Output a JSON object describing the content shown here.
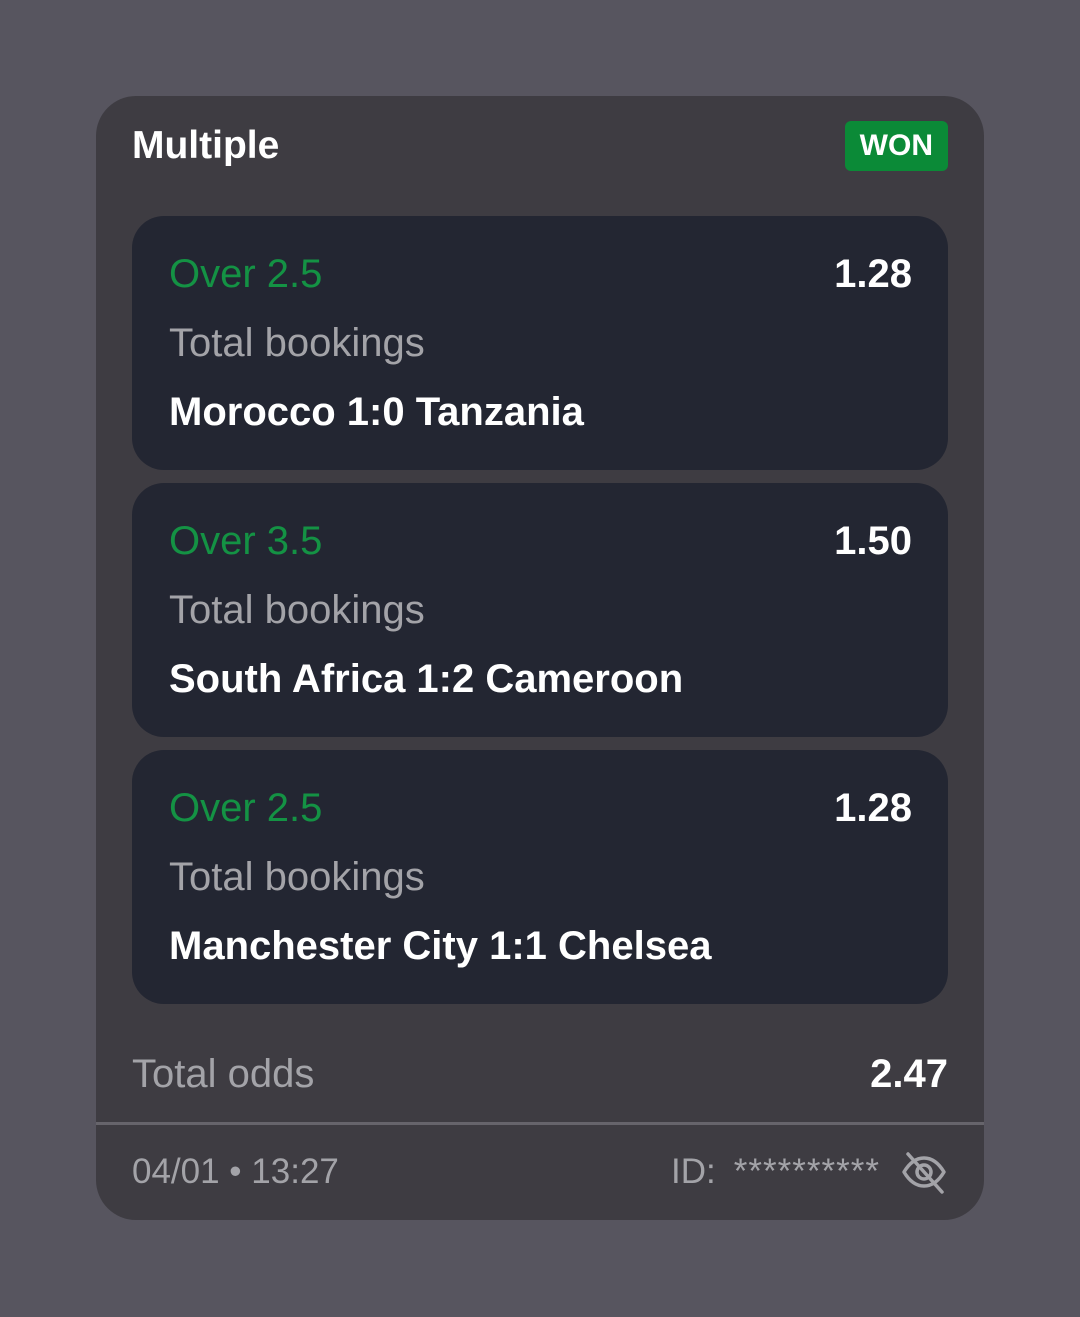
{
  "bet": {
    "type_label": "Multiple",
    "status_label": "WON",
    "status_color": "#0b8a37"
  },
  "legs": [
    {
      "selection": "Over 2.5",
      "odds": "1.28",
      "market": "Total bookings",
      "match": "Morocco 1:0 Tanzania"
    },
    {
      "selection": "Over 3.5",
      "odds": "1.50",
      "market": "Total bookings",
      "match": "South Africa 1:2 Cameroon"
    },
    {
      "selection": "Over 2.5",
      "odds": "1.28",
      "market": "Total bookings",
      "match": "Manchester City 1:1 Chelsea"
    }
  ],
  "totals": {
    "label": "Total odds",
    "value": "2.47"
  },
  "footer": {
    "timestamp": "04/01 • 13:27",
    "id_label": "ID:",
    "id_value": "**********",
    "toggle_icon": "eye-off-icon"
  }
}
